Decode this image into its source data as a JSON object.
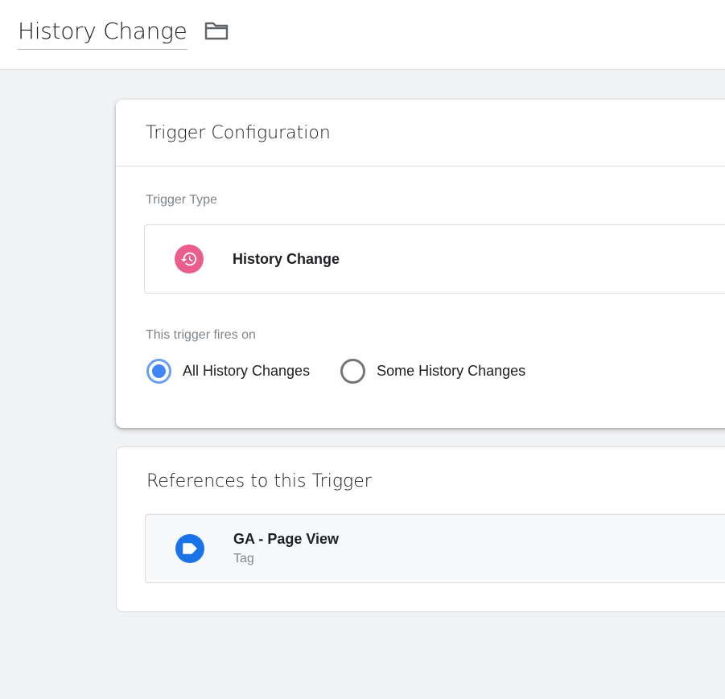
{
  "header": {
    "title": "History Change",
    "folder_icon": "folder-icon"
  },
  "trigger_config": {
    "heading": "Trigger Configuration",
    "type_label": "Trigger Type",
    "type": {
      "name": "History Change",
      "icon": "history-icon",
      "icon_color": "#ea5e8e"
    },
    "fires_on_label": "This trigger fires on",
    "fires_on_options": [
      {
        "label": "All History Changes",
        "selected": true
      },
      {
        "label": "Some History Changes",
        "selected": false
      }
    ]
  },
  "references": {
    "heading": "References to this Trigger",
    "items": [
      {
        "name": "GA - Page View",
        "kind": "Tag",
        "icon": "tag-icon",
        "icon_color": "#1a73e8"
      }
    ]
  },
  "colors": {
    "accent": "#4285f4",
    "background": "#f1f2f4"
  }
}
